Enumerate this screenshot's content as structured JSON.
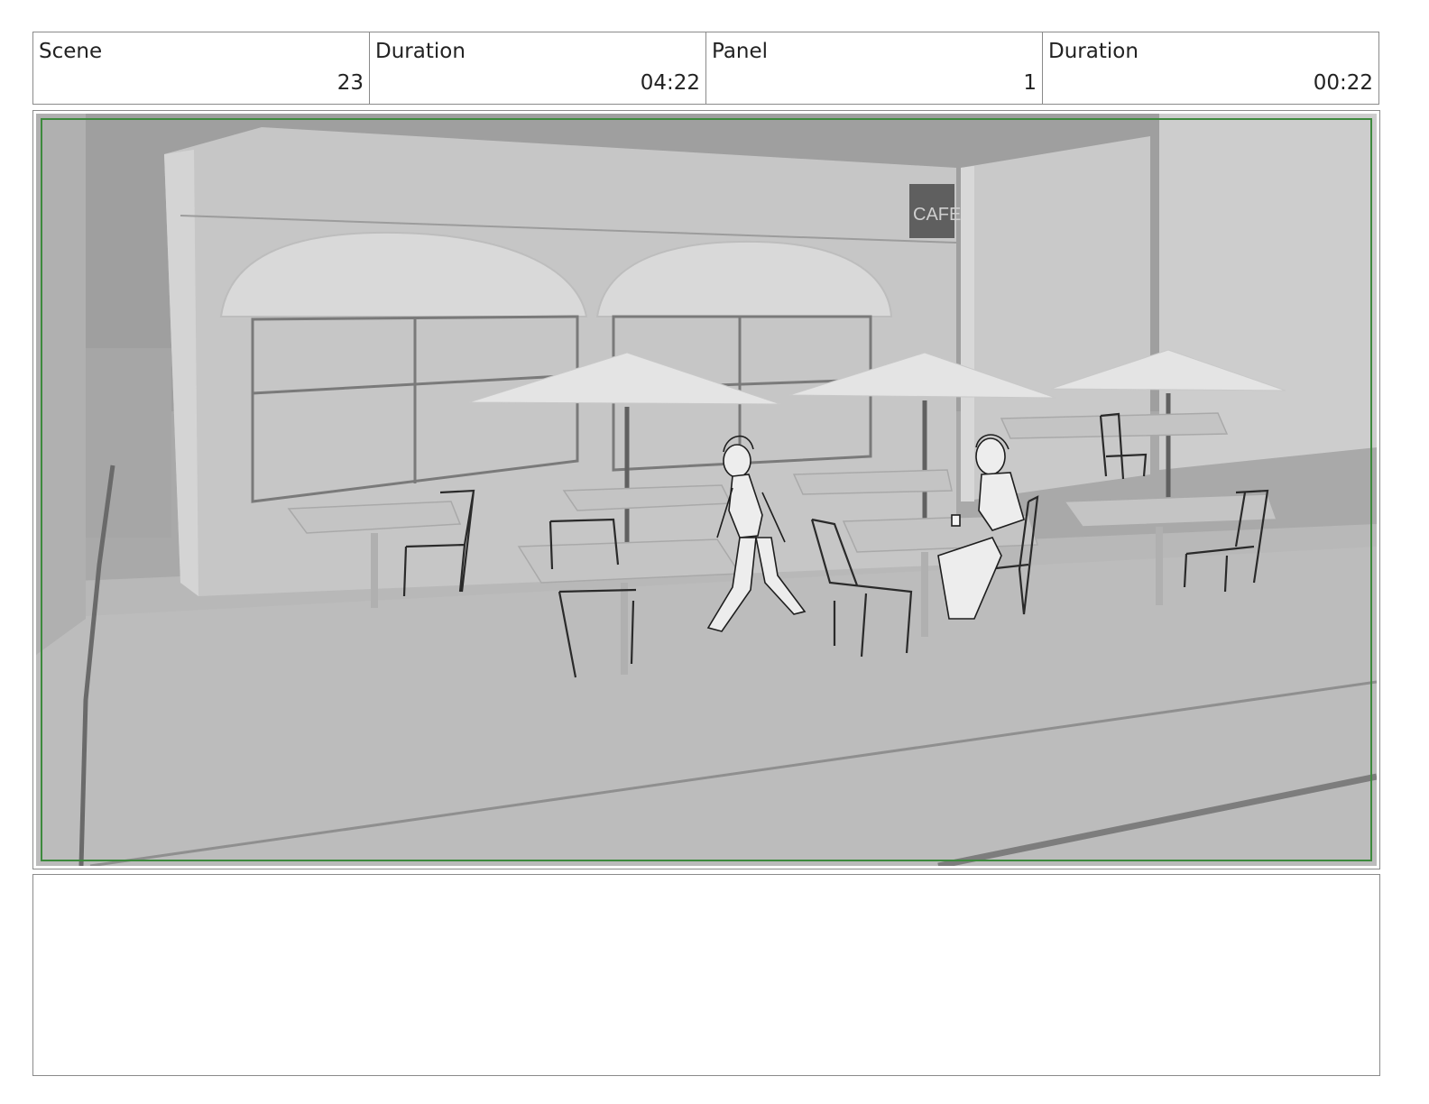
{
  "header": {
    "cells": [
      {
        "label": "Scene",
        "value": "23"
      },
      {
        "label": "Duration",
        "value": "04:22"
      },
      {
        "label": "Panel",
        "value": "1"
      },
      {
        "label": "Duration",
        "value": "00:22"
      }
    ]
  },
  "panel": {
    "sketch_sign_text": "CAFE",
    "safe_area_color": "#3d8a3d"
  },
  "notes": {
    "text": ""
  }
}
